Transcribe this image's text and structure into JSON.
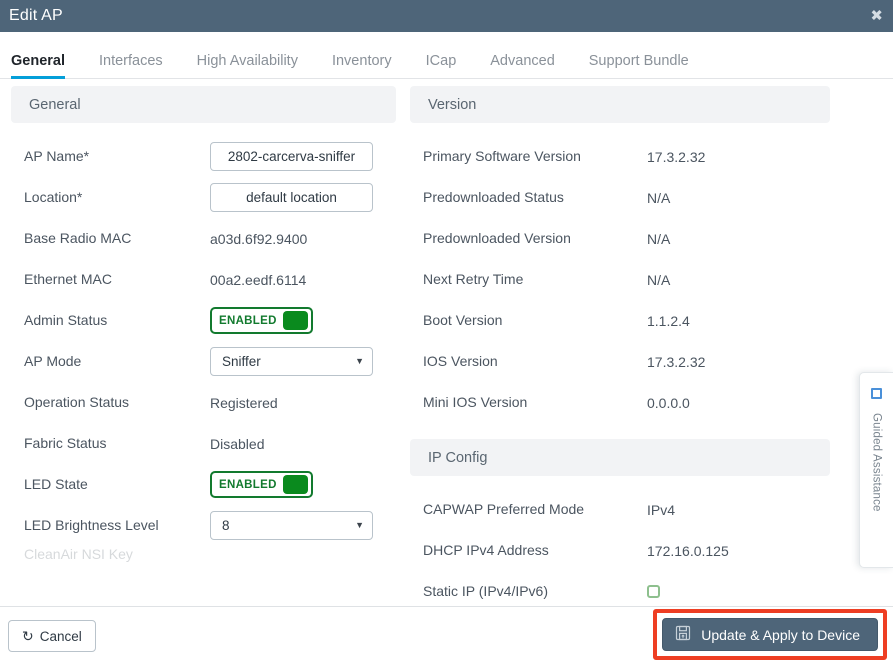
{
  "window": {
    "title": "Edit AP",
    "close_icon": "close-icon"
  },
  "tabs": [
    {
      "label": "General",
      "active": true
    },
    {
      "label": "Interfaces",
      "active": false
    },
    {
      "label": "High Availability",
      "active": false
    },
    {
      "label": "Inventory",
      "active": false
    },
    {
      "label": "ICap",
      "active": false
    },
    {
      "label": "Advanced",
      "active": false
    },
    {
      "label": "Support Bundle",
      "active": false
    }
  ],
  "left_column": {
    "section_title": "General",
    "rows": [
      {
        "label": "AP Name*",
        "type": "text",
        "value": "2802-carcerva-sniffer"
      },
      {
        "label": "Location*",
        "type": "text",
        "value": "default location"
      },
      {
        "label": "Base Radio MAC",
        "type": "static",
        "value": "a03d.6f92.9400"
      },
      {
        "label": "Ethernet MAC",
        "type": "static",
        "value": "00a2.eedf.6114"
      },
      {
        "label": "Admin Status",
        "type": "toggle",
        "value": "ENABLED"
      },
      {
        "label": "AP Mode",
        "type": "select",
        "value": "Sniffer"
      },
      {
        "label": "Operation Status",
        "type": "static",
        "value": "Registered"
      },
      {
        "label": "Fabric Status",
        "type": "static",
        "value": "Disabled"
      },
      {
        "label": "LED State",
        "type": "toggle",
        "value": "ENABLED"
      },
      {
        "label": "LED Brightness Level",
        "type": "select",
        "value": "8"
      }
    ],
    "clipped_row_label": "CleanAir NSI Key"
  },
  "right_column": {
    "section_title": "Version",
    "rows": [
      {
        "label": "Primary Software Version",
        "value": "17.3.2.32"
      },
      {
        "label": "Predownloaded Status",
        "value": "N/A"
      },
      {
        "label": "Predownloaded Version",
        "value": "N/A"
      },
      {
        "label": "Next Retry Time",
        "value": "N/A"
      },
      {
        "label": "Boot Version",
        "value": "1.1.2.4"
      },
      {
        "label": "IOS Version",
        "value": "17.3.2.32"
      },
      {
        "label": "Mini IOS Version",
        "value": "0.0.0.0"
      }
    ],
    "ip_section_title": "IP Config",
    "ip_rows": [
      {
        "label": "CAPWAP Preferred Mode",
        "type": "static",
        "value": "IPv4"
      },
      {
        "label": "DHCP IPv4 Address",
        "type": "static",
        "value": "172.16.0.125"
      },
      {
        "label": "Static IP (IPv4/IPv6)",
        "type": "checkbox",
        "value": ""
      }
    ]
  },
  "guided_assistance": {
    "label": "Guided Assistance",
    "icon": "square-outline-icon"
  },
  "footer": {
    "cancel_label": "Cancel",
    "cancel_icon": "undo-arrow-icon",
    "update_label": "Update & Apply to Device",
    "update_icon": "save-icon"
  },
  "colors": {
    "titlebar": "#4e6579",
    "active_tab_underline": "#049fd9",
    "toggle_green": "#0a8a1e",
    "highlight_red": "#ee3e23",
    "section_band": "#f2f3f5"
  }
}
